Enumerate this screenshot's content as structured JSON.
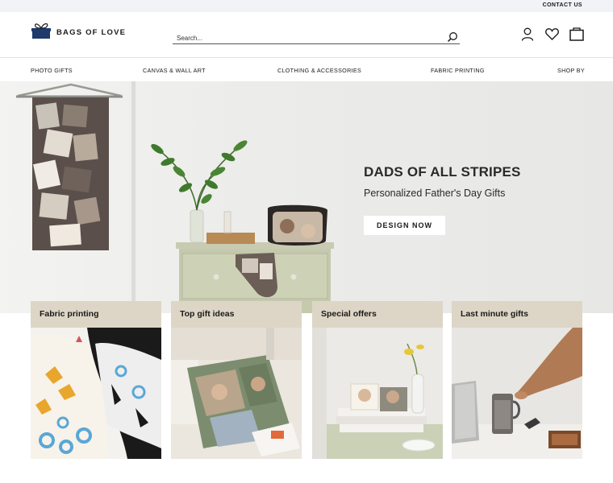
{
  "topbar": {
    "contact_label": "CONTACT US"
  },
  "header": {
    "logo_text": "BAGS OF LOVE",
    "search_placeholder": "Search...",
    "icons": [
      "account-icon",
      "heart-icon",
      "bag-icon"
    ]
  },
  "nav": {
    "items": [
      {
        "label": "PHOTO GIFTS"
      },
      {
        "label": "CANVAS & WALL ART"
      },
      {
        "label": "CLOTHING & ACCESSORIES"
      },
      {
        "label": "FABRIC PRINTING"
      },
      {
        "label": "SHOP BY"
      }
    ]
  },
  "hero": {
    "title": "DADS OF ALL STRIPES",
    "subtitle": "Personalized Father's Day Gifts",
    "button_label": "DESIGN NOW"
  },
  "cards": [
    {
      "label": "Fabric printing"
    },
    {
      "label": "Top gift ideas"
    },
    {
      "label": "Special offers"
    },
    {
      "label": "Last minute gifts"
    }
  ],
  "colors": {
    "card_header": "#ddd6c6",
    "logo_blue": "#1f3a6b",
    "hero_bg": "#ececea"
  }
}
